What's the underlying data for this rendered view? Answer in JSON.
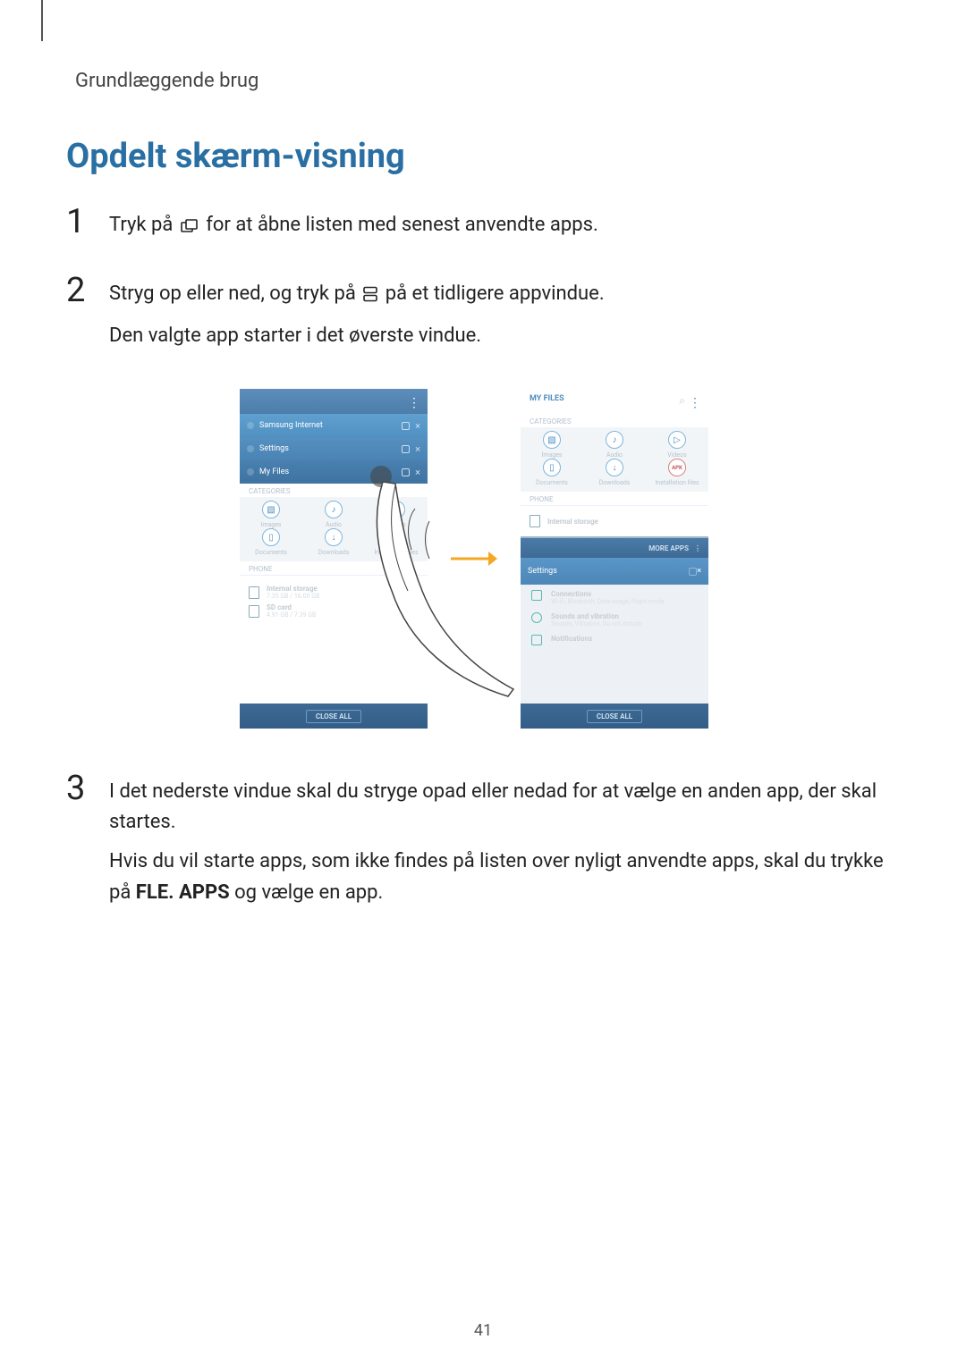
{
  "header": {
    "section": "Grundlæggende brug"
  },
  "title": "Opdelt skærm-visning",
  "steps": {
    "s1": {
      "num": "1",
      "before": "Tryk på ",
      "after": " for at åbne listen med senest anvendte apps."
    },
    "s2": {
      "num": "2",
      "before": "Stryg op eller ned, og tryk på ",
      "after": " på et tidligere appvindue.",
      "line2": "Den valgte app starter i det øverste vindue."
    },
    "s3": {
      "num": "3",
      "line1": "I det nederste vindue skal du stryge opad eller nedad for at vælge en anden app, der skal startes.",
      "line2_before": "Hvis du vil starte apps, som ikke findes på listen over nyligt anvendte apps, skal du trykke på ",
      "line2_bold": "FLE. APPS",
      "line2_after": " og vælge en app."
    }
  },
  "mock": {
    "myfiles": "MY FILES",
    "categories": "CATEGORIES",
    "grid": {
      "images": "Images",
      "audio": "Audio",
      "videos": "Videos",
      "documents": "Documents",
      "downloads": "Downloads",
      "install": "Installation files",
      "apk": "APK"
    },
    "phone_label": "PHONE",
    "internal": "Internal storage",
    "internal_sub": "7.35 GB / 16.00 GB",
    "sd": "SD card",
    "sd_sub": "4.91 GB / 7.39 GB",
    "more": "MORE APPS",
    "settings": "Settings",
    "set_items": {
      "conn": "Connections",
      "conn_sub": "Wi-Fi, Bluetooth, Data usage, Flight mode",
      "sound": "Sounds and vibration",
      "sound_sub": "Sounds, Vibration, Do not disturb",
      "notif": "Notifications"
    },
    "close_all": "CLOSE ALL",
    "samsung_internet": "Samsung Internet",
    "my_files_item": "My Files"
  },
  "page_number": "41"
}
